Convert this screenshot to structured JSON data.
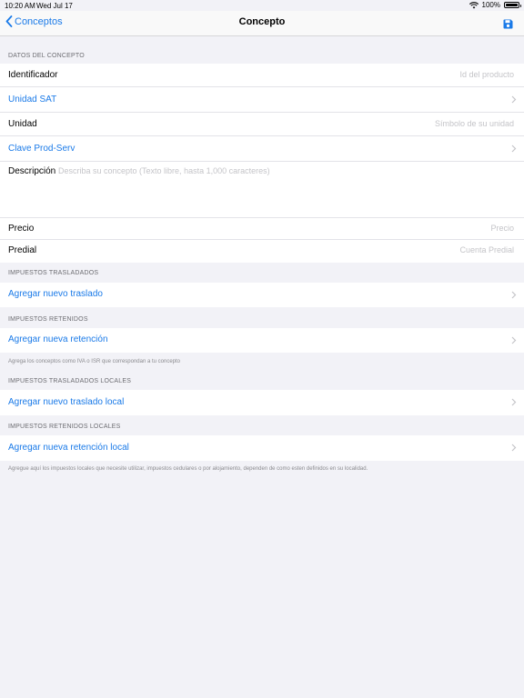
{
  "status": {
    "time": "10:20 AM",
    "date": "Wed Jul 17",
    "battery": "100%"
  },
  "nav": {
    "back_label": "Conceptos",
    "title": "Concepto"
  },
  "sections": {
    "datos": {
      "header": "DATOS DEL CONCEPTO",
      "identificador": {
        "label": "Identificador",
        "placeholder": "Id del producto"
      },
      "unidad_sat": {
        "label": "Unidad SAT"
      },
      "unidad": {
        "label": "Unidad",
        "placeholder": "Símbolo de su unidad"
      },
      "clave": {
        "label": "Clave Prod-Serv"
      },
      "descripcion": {
        "label": "Descripción",
        "placeholder": "Describa su concepto (Texto libre, hasta 1,000 caracteres)"
      },
      "precio": {
        "label": "Precio",
        "placeholder": "Precio"
      },
      "predial": {
        "label": "Predial",
        "placeholder": "Cuenta Predial"
      }
    },
    "trasladados": {
      "header": "IMPUESTOS TRASLADADOS",
      "action": "Agregar nuevo traslado"
    },
    "retenidos": {
      "header": "IMPUESTOS RETENIDOS",
      "action": "Agregar nueva retención",
      "footer": "Agrega los conceptos como IVA o ISR que correspondan a tu concepto"
    },
    "trasladados_locales": {
      "header": "IMPUESTOS TRASLADADOS LOCALES",
      "action": "Agregar nuevo traslado local"
    },
    "retenidos_locales": {
      "header": "IMPUESTOS RETENIDOS LOCALES",
      "action": "Agregar nueva retención local",
      "footer": "Agregue aquí los impuestos locales que necesite utilizar, impuestos cedulares o por alojamiento, dependen de como esten definidos en su localidad."
    }
  },
  "colors": {
    "accent": "#1a7ae8",
    "background": "#f2f2f7",
    "placeholder": "#c4c4c8"
  }
}
